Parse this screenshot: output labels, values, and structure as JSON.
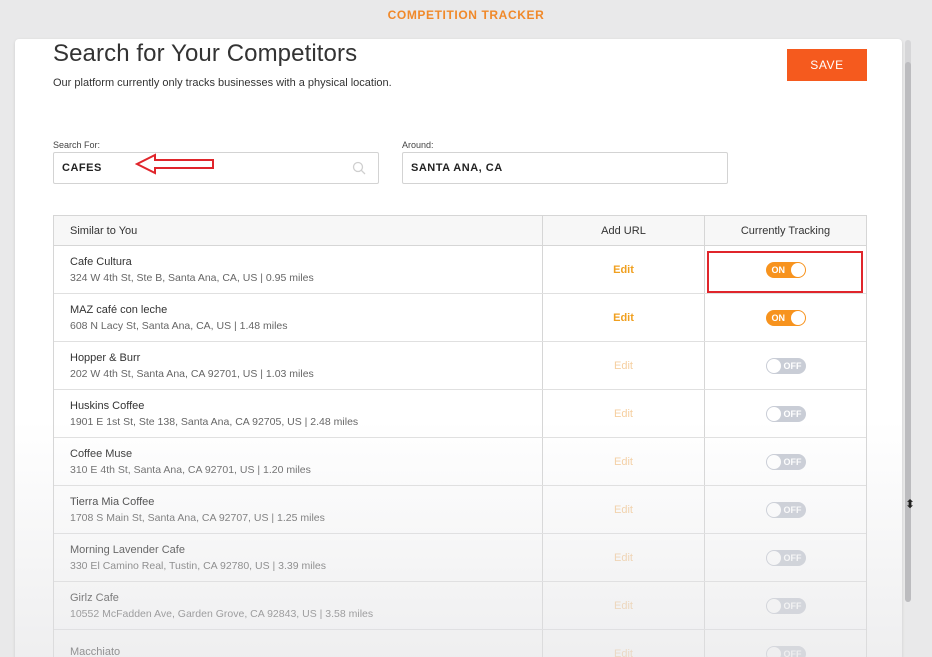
{
  "app": {
    "title": "COMPETITION TRACKER"
  },
  "page": {
    "title": "Search for Your Competitors",
    "subtitle": "Our platform currently only tracks businesses with a physical location.",
    "save_label": "SAVE"
  },
  "search": {
    "search_for_label": "Search For:",
    "search_for_value": "CAFES",
    "around_label": "Around:",
    "around_value": "SANTA ANA, CA"
  },
  "table": {
    "headers": [
      "Similar to You",
      "Add URL",
      "Currently Tracking"
    ],
    "rows": [
      {
        "name": "Cafe Cultura",
        "address": "324 W 4th St, Ste B, Santa Ana, CA, US | 0.95 miles",
        "edit": "Edit",
        "tracking": "ON"
      },
      {
        "name": "MAZ café con leche",
        "address": "608 N Lacy St, Santa Ana, CA, US | 1.48 miles",
        "edit": "Edit",
        "tracking": "ON"
      },
      {
        "name": "Hopper & Burr",
        "address": "202 W 4th St, Santa Ana, CA 92701, US | 1.03 miles",
        "edit": "Edit",
        "tracking": "OFF"
      },
      {
        "name": "Huskins Coffee",
        "address": "1901 E 1st St, Ste 138, Santa Ana, CA 92705, US | 2.48 miles",
        "edit": "Edit",
        "tracking": "OFF"
      },
      {
        "name": "Coffee Muse",
        "address": "310 E 4th St, Santa Ana, CA 92701, US | 1.20 miles",
        "edit": "Edit",
        "tracking": "OFF"
      },
      {
        "name": "Tierra Mia Coffee",
        "address": "1708 S Main St, Santa Ana, CA 92707, US | 1.25 miles",
        "edit": "Edit",
        "tracking": "OFF"
      },
      {
        "name": "Morning Lavender Cafe",
        "address": "330 El Camino Real, Tustin, CA 92780, US | 3.39 miles",
        "edit": "Edit",
        "tracking": "OFF"
      },
      {
        "name": "Girlz Cafe",
        "address": "10552 McFadden Ave, Garden Grove, CA 92843, US | 3.58 miles",
        "edit": "Edit",
        "tracking": "OFF"
      },
      {
        "name": "Macchiato",
        "address": "",
        "edit": "Edit",
        "tracking": "OFF"
      }
    ]
  },
  "colors": {
    "accent": "#f55a1e",
    "toggle_on": "#f7931e",
    "toggle_off": "#c9cdd6",
    "annotation": "#e0252b"
  },
  "icons": {
    "search": "search-icon",
    "cursor": "mouse-cursor-icon"
  }
}
